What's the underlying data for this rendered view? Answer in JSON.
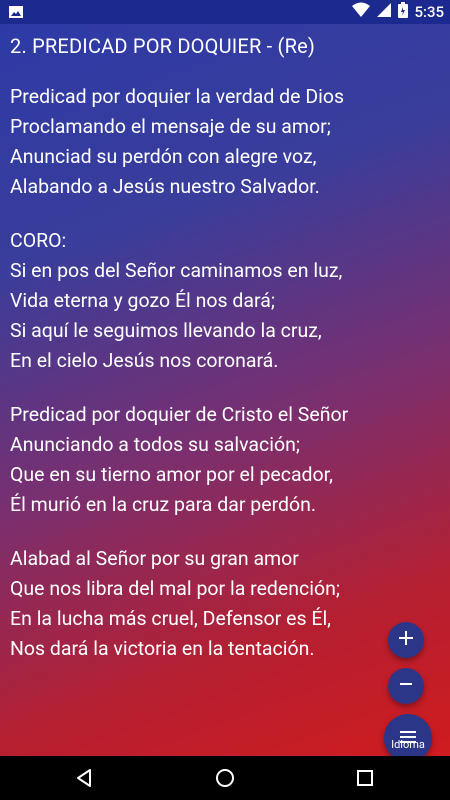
{
  "status": {
    "time": "5:35"
  },
  "song": {
    "title": "2. PREDICAD POR DOQUIER - (Re)",
    "stanzas": [
      [
        "Predicad por doquier la verdad de Dios",
        "Proclamando el mensaje de su amor;",
        "Anunciad su perdón con alegre voz,",
        "Alabando a Jesús nuestro Salvador."
      ],
      [
        "CORO:",
        "Si en pos del Señor caminamos en luz,",
        "Vida eterna y gozo Él nos dará;",
        "Si aquí le seguimos llevando la cruz,",
        "En el cielo Jesús nos coronará."
      ],
      [
        "Predicad por doquier de Cristo el Señor",
        "Anunciando a todos su salvación;",
        "Que en su tierno amor por el pecador,",
        "Él murió en la cruz para dar perdón."
      ],
      [
        "Alabad al Señor por su gran amor",
        "Que nos libra del mal por la redención;",
        "En la lucha más cruel, Defensor es Él,",
        "Nos dará la victoria en la tentación."
      ]
    ]
  },
  "fab": {
    "menu_label": "Idioma"
  },
  "icons": {
    "status_left": "image-icon",
    "wifi": "wifi-icon",
    "signal": "signal-icon",
    "battery": "battery-icon",
    "zoom_in": "plus-icon",
    "zoom_out": "minus-icon",
    "menu": "menu-icon",
    "back": "back-icon",
    "home": "home-icon",
    "recents": "recents-icon"
  },
  "colors": {
    "status_bar": "#1c2a8f",
    "fab": "#2c3689",
    "gradient_top": "#2d3aa6",
    "gradient_bottom": "#d01c1f"
  }
}
